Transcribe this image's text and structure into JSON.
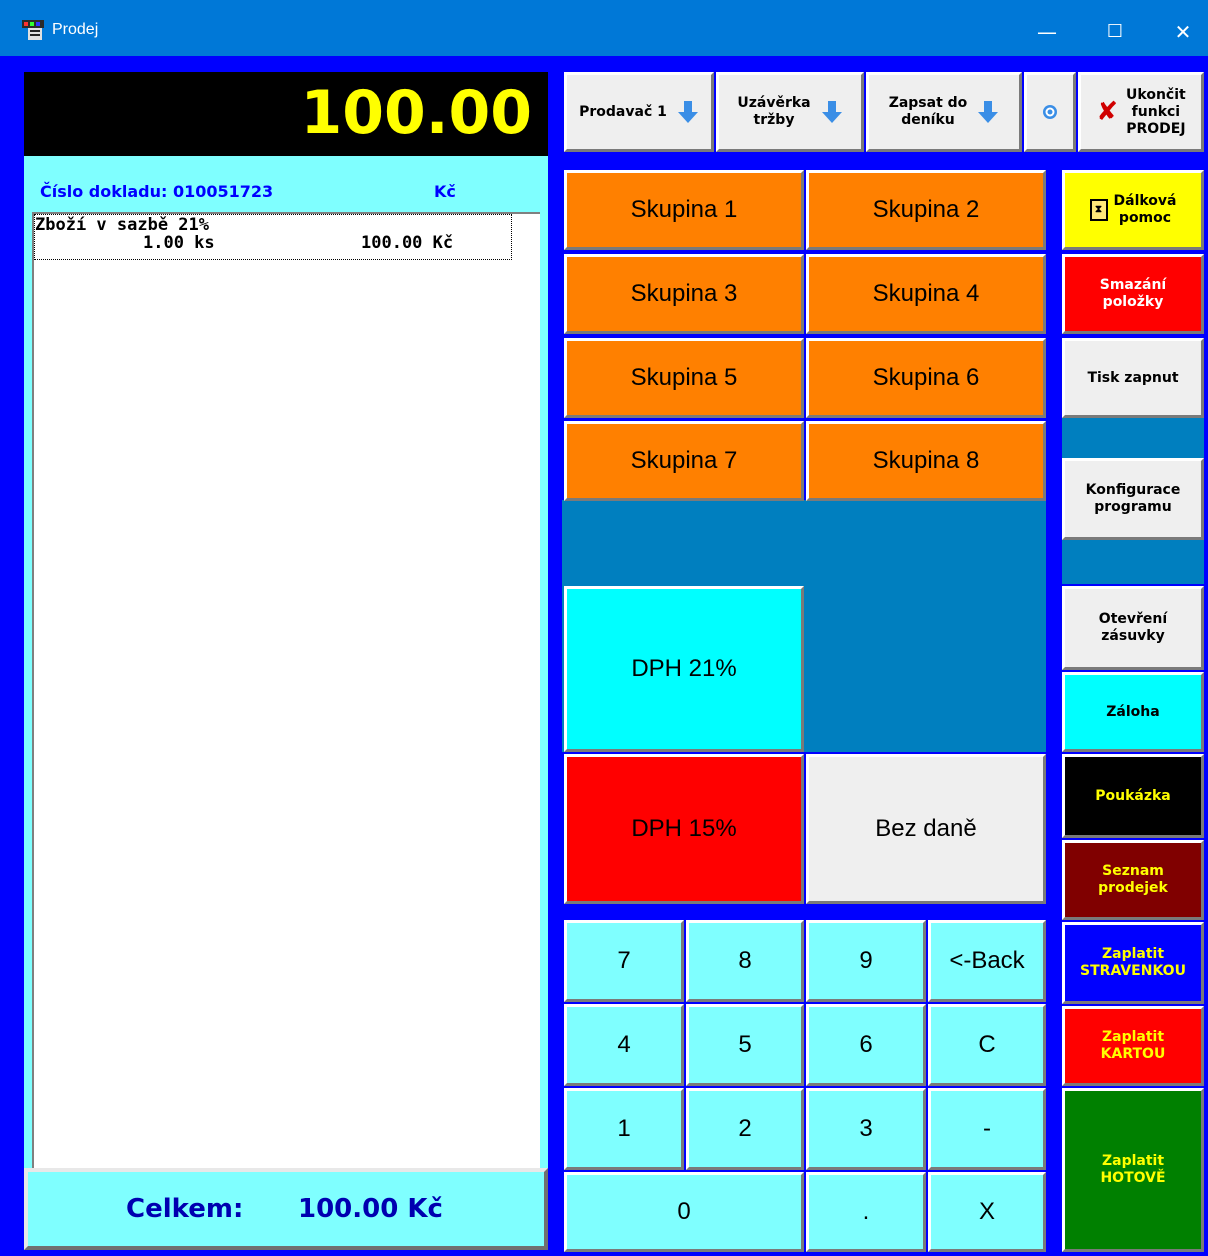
{
  "window": {
    "title": "Prodej",
    "minimize": "—",
    "maximize": "☐",
    "close": "✕"
  },
  "display": {
    "amount": "100.00"
  },
  "receipt": {
    "doc_label": "Číslo dokladu: 010051723",
    "currency_label": "Kč",
    "line1": "Zboží v sazbě 21%",
    "line2_qty": "1.00 ks",
    "line2_price": "100.00 Kč"
  },
  "total": {
    "label": "Celkem:",
    "value": "100.00 Kč"
  },
  "toolbar": {
    "seller": "Prodavač 1",
    "closing_l1": "Uzávěrka",
    "closing_l2": "tržby",
    "journal_l1": "Zapsat do",
    "journal_l2": "deníku",
    "exit_l1": "Ukončit",
    "exit_l2": "funkci",
    "exit_l3": "PRODEJ"
  },
  "groups": [
    "Skupina 1",
    "Skupina 2",
    "Skupina 3",
    "Skupina 4",
    "Skupina 5",
    "Skupina 6",
    "Skupina 7",
    "Skupina 8"
  ],
  "vat": {
    "dph21": "DPH 21%",
    "dph15": "DPH 15%",
    "none": "Bez daně"
  },
  "keypad": {
    "k7": "7",
    "k8": "8",
    "k9": "9",
    "back": "<-Back",
    "k4": "4",
    "k5": "5",
    "k6": "6",
    "clear": "C",
    "k1": "1",
    "k2": "2",
    "k3": "3",
    "minus": "-",
    "k0": "0",
    "dot": ".",
    "times": "X"
  },
  "side": {
    "remote_l1": "Dálková",
    "remote_l2": "pomoc",
    "delete_l1": "Smazání",
    "delete_l2": "položky",
    "print": "Tisk zapnut",
    "config_l1": "Konfigurace",
    "config_l2": "programu",
    "drawer_l1": "Otevření",
    "drawer_l2": "zásuvky",
    "deposit": "Záloha",
    "voucher": "Poukázka",
    "receipts_l1": "Seznam",
    "receipts_l2": "prodejek",
    "meal_l1": "Zaplatit",
    "meal_l2": "STRAVENKOU",
    "card_l1": "Zaplatit",
    "card_l2": "KARTOU",
    "cash_l1": "Zaplatit",
    "cash_l2": "HOTOVĚ"
  },
  "colors": {
    "frame": "#0000ff",
    "titlebar": "#0078d7",
    "group": "#ff8000",
    "keypad": "#7fffff",
    "remote": "#ffff00",
    "delete": "#ff0000",
    "voucher": "#000000",
    "receipts": "#800000",
    "meal": "#0000ff",
    "card": "#ff0000",
    "cash": "#008000",
    "cyan_button": "#00ffff"
  }
}
